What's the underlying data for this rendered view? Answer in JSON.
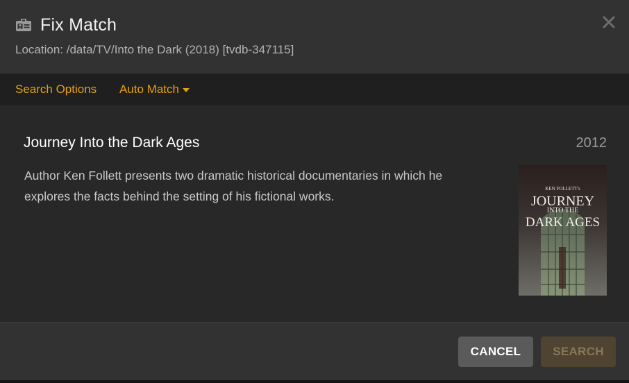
{
  "dialog": {
    "title": "Fix Match",
    "location": "Location: /data/TV/Into the Dark (2018) [tvdb-347115]",
    "close_icon": "close-icon",
    "title_icon": "id-card-icon"
  },
  "subnav": {
    "search_options": "Search Options",
    "auto_match": "Auto Match",
    "accent_color": "#e5a00d"
  },
  "result": {
    "title": "Journey Into the Dark Ages",
    "year": "2012",
    "summary": "Author Ken Follett presents two dramatic historical documentaries in which he explores the facts behind the setting of his fictional works.",
    "poster": {
      "line1": "KEN FOLLETT's",
      "line2": "JOURNEY",
      "line3": "INTO THE",
      "line4": "DARK AGES"
    }
  },
  "footer": {
    "cancel_label": "CANCEL",
    "search_label": "SEARCH"
  }
}
